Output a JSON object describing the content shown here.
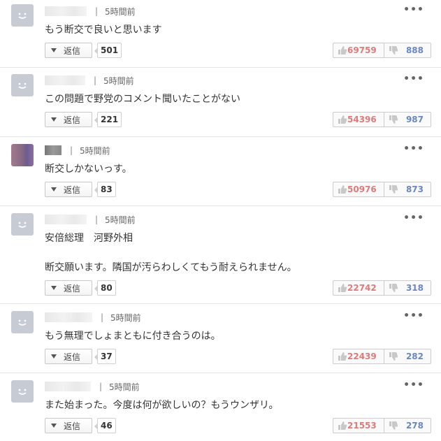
{
  "colors": {
    "like": "#e07a7a",
    "dislike": "#6b87c2",
    "avatar_default": "#c7cbd3"
  },
  "icons": {
    "more": "more-dots-icon",
    "reply": "caret-down-icon",
    "like": "thumbs-up-icon",
    "dislike": "thumbs-down-icon",
    "avatar": "default-avatar-smile-icon"
  },
  "labels": {
    "reply": "返信",
    "more": "•••",
    "separator": "|"
  },
  "comments": [
    {
      "time": "5時間前",
      "text": "もう断交で良いと思います",
      "replies": "501",
      "likes": "69759",
      "dislikes": "888"
    },
    {
      "time": "5時間前",
      "text": "この問題で野党のコメント聞いたことがない",
      "replies": "221",
      "likes": "54396",
      "dislikes": "987"
    },
    {
      "time": "5時間前",
      "text": "断交しかないっす。",
      "replies": "83",
      "likes": "50976",
      "dislikes": "873"
    },
    {
      "time": "5時間前",
      "text": "安倍総理　河野外相\n\n断交願います。隣国が汚らわしくてもう耐えられません。",
      "replies": "80",
      "likes": "22742",
      "dislikes": "318"
    },
    {
      "time": "5時間前",
      "text": "もう無理でしょまともに付き合うのは。",
      "replies": "37",
      "likes": "22439",
      "dislikes": "282"
    },
    {
      "time": "5時間前",
      "text": "また始まった。今度は何が欲しいの？もうウンザリ。",
      "replies": "46",
      "likes": "21553",
      "dislikes": "278"
    }
  ]
}
